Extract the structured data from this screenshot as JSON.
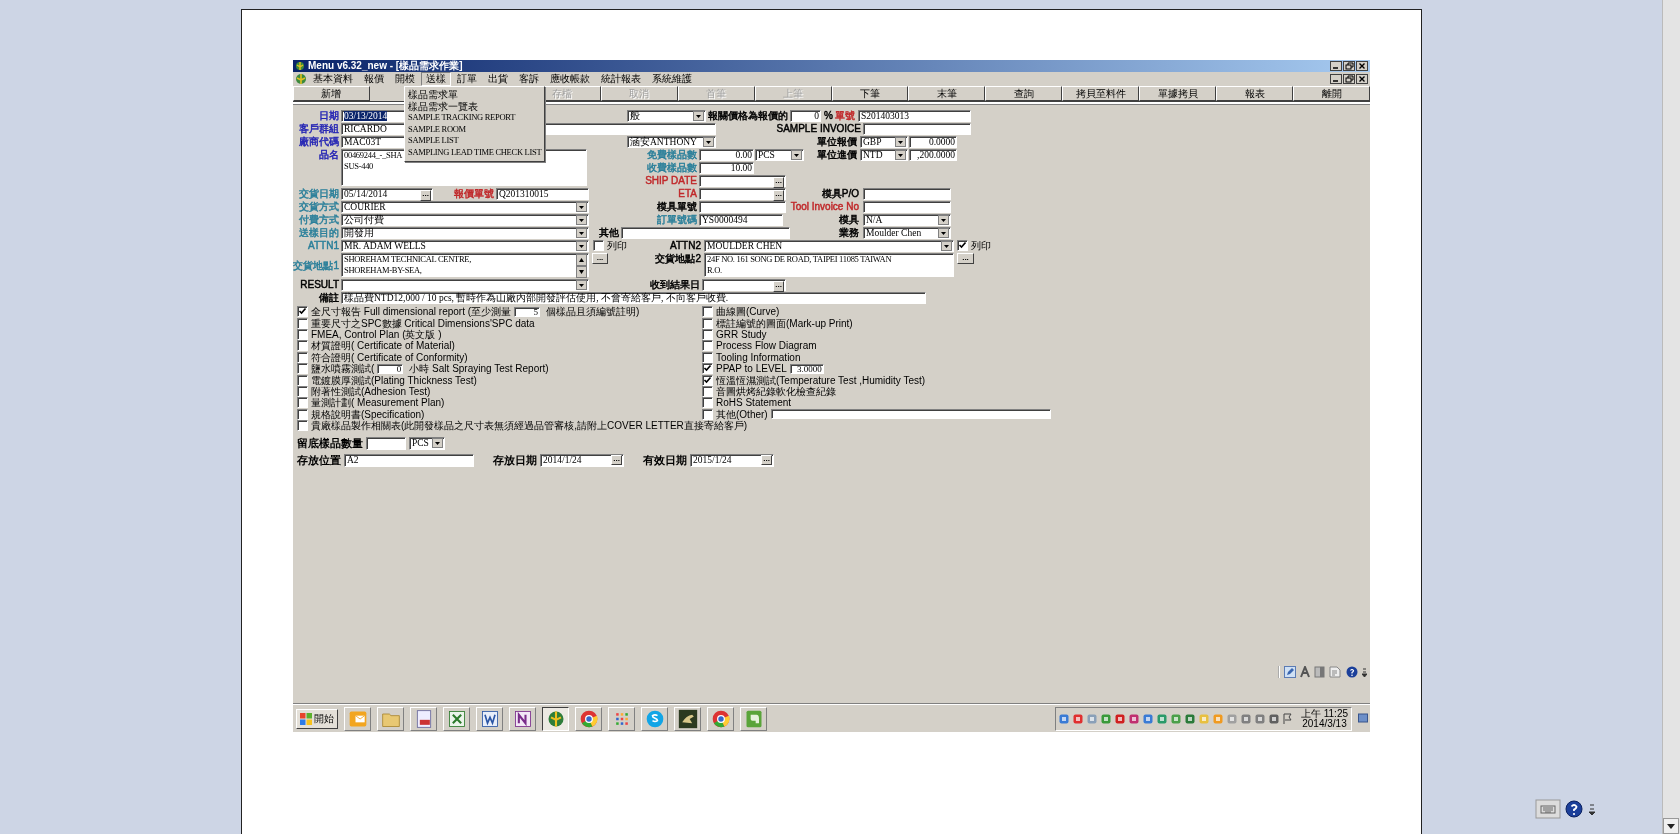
{
  "window": {
    "title": "Menu v6.32_new - [樣品需求作業]"
  },
  "menu_bar": {
    "items": [
      {
        "label": "基本資料",
        "selected": false
      },
      {
        "label": "報價",
        "selected": false
      },
      {
        "label": "開模",
        "selected": false
      },
      {
        "label": "送樣",
        "selected": true
      },
      {
        "label": "訂單",
        "selected": false
      },
      {
        "label": "出貨",
        "selected": false
      },
      {
        "label": "客訴",
        "selected": false
      },
      {
        "label": "應收帳款",
        "selected": false
      },
      {
        "label": "統計報表",
        "selected": false
      },
      {
        "label": "系統維護",
        "selected": false
      }
    ]
  },
  "dropdown_menu": {
    "items": [
      "樣品需求單",
      "樣品需求一覽表",
      "SAMPLE TRACKING REPORT",
      "SAMPLE ROOM",
      "SAMPLE LIST",
      "SAMPLING LEAD TIME CHECK LIST"
    ]
  },
  "toolbar": {
    "buttons": [
      {
        "label": "新增",
        "disabled": false
      },
      {
        "label": "存檔",
        "disabled": true
      },
      {
        "label": "取消",
        "disabled": true
      },
      {
        "label": "首筆",
        "disabled": true
      },
      {
        "label": "上筆",
        "disabled": true
      },
      {
        "label": "下筆",
        "disabled": false
      },
      {
        "label": "末筆",
        "disabled": false
      },
      {
        "label": "查詢",
        "disabled": false
      },
      {
        "label": "拷貝至料件",
        "disabled": false
      },
      {
        "label": "單據拷貝",
        "disabled": false
      },
      {
        "label": "報表",
        "disabled": false
      },
      {
        "label": "離開",
        "disabled": false
      }
    ]
  },
  "form": {
    "items": [
      {
        "kind": "label",
        "text": "日期",
        "color": "#2424b4"
      },
      {
        "kind": "text",
        "value": "03/13/2014",
        "highlighted": true
      },
      {
        "kind": "combo",
        "value": "般"
      },
      {
        "kind": "label",
        "text": "報關價格為報價的",
        "color": "#000000"
      },
      {
        "kind": "number",
        "value": "0"
      },
      {
        "kind": "label",
        "text": "%"
      },
      {
        "kind": "label",
        "text": "單號",
        "color": "#c0282a"
      },
      {
        "kind": "text",
        "value": "S201403013"
      },
      {
        "kind": "label",
        "text": "客戶群組",
        "color": "#2424b4"
      },
      {
        "kind": "text",
        "value": "RICARDO"
      },
      {
        "kind": "label",
        "text": "SAMPLE INVOICE",
        "color": "#000000"
      },
      {
        "kind": "text"
      },
      {
        "kind": "label",
        "text": "廠商代碼",
        "color": "#2424b4"
      },
      {
        "kind": "text",
        "value": "MAC03T"
      },
      {
        "kind": "combo",
        "value": "涵安ANTHONY"
      },
      {
        "kind": "label",
        "text": "單位報價",
        "color": "#000000"
      },
      {
        "kind": "combo",
        "value": "GBP"
      },
      {
        "kind": "number",
        "value": "0.0000"
      },
      {
        "kind": "label",
        "text": "品名",
        "color": "#2424b4"
      },
      {
        "kind": "memo",
        "lines": [
          "00469244_-_SHA",
          "SUS-440"
        ],
        "scrollbar": false
      },
      {
        "kind": "label",
        "text": "免費樣品數",
        "color": "#2a7f9a"
      },
      {
        "kind": "number",
        "value": "0.00"
      },
      {
        "kind": "combo",
        "value": "PCS"
      },
      {
        "kind": "label",
        "text": "單位進價",
        "color": "#000000"
      },
      {
        "kind": "combo",
        "value": "NTD"
      },
      {
        "kind": "number",
        "value": ",200.0000"
      },
      {
        "kind": "label",
        "text": "收費樣品數",
        "color": "#2a7f9a"
      },
      {
        "kind": "number",
        "value": "10.00"
      },
      {
        "kind": "label",
        "text": "SHIP DATE",
        "color": "#c0282a"
      },
      {
        "kind": "date",
        "button": "..."
      },
      {
        "kind": "label",
        "text": "交貨日期",
        "color": "#2a7f9a"
      },
      {
        "kind": "date",
        "value": "05/14/2014",
        "button": "..."
      },
      {
        "kind": "label",
        "text": "報價單號",
        "color": "#c0282a"
      },
      {
        "kind": "text",
        "value": "Q201310015"
      },
      {
        "kind": "label",
        "text": "ETA",
        "color": "#c0282a"
      },
      {
        "kind": "date",
        "button": "..."
      },
      {
        "kind": "label",
        "text": "模具P/O",
        "color": "#000000"
      },
      {
        "kind": "text"
      },
      {
        "kind": "label",
        "text": "交貨方式",
        "color": "#2a7f9a"
      },
      {
        "kind": "combo",
        "value": "COURIER"
      },
      {
        "kind": "label",
        "text": "模具單號",
        "color": "#000000"
      },
      {
        "kind": "text"
      },
      {
        "kind": "label",
        "text": "Tool Invoice No",
        "color": "#c0282a"
      },
      {
        "kind": "text"
      },
      {
        "kind": "label",
        "text": "付費方式",
        "color": "#2a7f9a"
      },
      {
        "kind": "combo",
        "value": "公司付費"
      },
      {
        "kind": "label",
        "text": "訂單號碼",
        "color": "#2a7f9a"
      },
      {
        "kind": "text",
        "value": "YS0000494"
      },
      {
        "kind": "label",
        "text": "模具",
        "color": "#000000"
      },
      {
        "kind": "combo",
        "value": "N/A"
      },
      {
        "kind": "label",
        "text": "送樣目的",
        "color": "#2a7f9a"
      },
      {
        "kind": "combo",
        "value": "開發用"
      },
      {
        "kind": "label",
        "text": "其他",
        "color": "#000000"
      },
      {
        "kind": "text"
      },
      {
        "kind": "label",
        "text": "業務",
        "color": "#000000"
      },
      {
        "kind": "combo",
        "value": "Moulder Chen"
      },
      {
        "kind": "label",
        "text": "ATTN1",
        "color": "#2a7f9a"
      },
      {
        "kind": "combo",
        "value": "MR. ADAM WELLS"
      },
      {
        "kind": "checkbox",
        "text": "列印",
        "checked": false
      },
      {
        "kind": "label",
        "text": "ATTN2",
        "color": "#000000"
      },
      {
        "kind": "combo",
        "value": "MOULDER CHEN"
      },
      {
        "kind": "checkbox",
        "text": "列印",
        "checked": true
      },
      {
        "kind": "label",
        "text": "交貨地點1",
        "color": "#2a7f9a"
      },
      {
        "kind": "memo",
        "lines": [
          "SHOREHAM TECHNICAL CENTRE,",
          "SHOREHAM-BY-SEA,"
        ],
        "scrollbar": true
      },
      {
        "kind": "button",
        "text": "..."
      },
      {
        "kind": "label",
        "text": "交貨地點2",
        "color": "#000000"
      },
      {
        "kind": "memo",
        "lines": [
          "24F NO. 161 SONG DE ROAD, TAIPEI 11085 TAIWAN",
          "R.O."
        ],
        "scrollbar": false
      },
      {
        "kind": "button",
        "text": "..."
      },
      {
        "kind": "label",
        "text": "RESULT",
        "color": "#000000"
      },
      {
        "kind": "combo"
      },
      {
        "kind": "label",
        "text": "收到結果日",
        "color": "#000000"
      },
      {
        "kind": "date",
        "button": "..."
      },
      {
        "kind": "label",
        "text": "備註",
        "color": "#000000"
      },
      {
        "kind": "text",
        "value": "樣品費NTD12,000 / 10 pcs, 暫時作為山廠內部開發評估使用, 不會寄給客戶, 不向客戶收費."
      }
    ]
  },
  "checklist": {
    "left": [
      {
        "kind": "field",
        "text": "全尺寸報告 Full dimensional report (至少測量",
        "field_value": "5",
        "text_after": "個樣品且須編號註明)",
        "checked": true
      },
      {
        "kind": "plain",
        "text": "重要尺寸之SPC數據 Critical Dimensions'SPC data",
        "checked": false
      },
      {
        "kind": "plain",
        "text": "FMEA, Control Plan (英文版 )",
        "checked": false
      },
      {
        "kind": "plain",
        "text": "材質證明( Certificate of Material)",
        "checked": false
      },
      {
        "kind": "plain",
        "text": "符合證明( Certificate of Conformity)",
        "checked": false
      },
      {
        "kind": "field",
        "text": "鹽水噴霧測試(",
        "field_value": "0",
        "text_after": "小時 Salt Spraying Test Report)",
        "checked": false
      },
      {
        "kind": "plain",
        "text": "電鍍膜厚測試(Plating Thickness Test)",
        "checked": false
      },
      {
        "kind": "plain",
        "text": "附著性測試(Adhesion Test)",
        "checked": false
      },
      {
        "kind": "plain",
        "text": "量測計劃( Measurement Plan)",
        "checked": false
      },
      {
        "kind": "plain",
        "text": "規格說明書(Specification)",
        "checked": false
      }
    ],
    "right": [
      {
        "kind": "plain",
        "text": "曲線圖(Curve)",
        "checked": false
      },
      {
        "kind": "plain",
        "text": "標註編號的圖面(Mark-up Print)",
        "checked": false
      },
      {
        "kind": "plain",
        "text": "GRR Study",
        "checked": false
      },
      {
        "kind": "plain",
        "text": "Process Flow Diagram",
        "checked": false
      },
      {
        "kind": "plain",
        "text": "Tooling Information",
        "checked": false
      },
      {
        "kind": "field",
        "text": "PPAP  to LEVEL",
        "field_value": "3.0000",
        "checked": true
      },
      {
        "kind": "plain",
        "text": "恆溫恆濕測試(Temperature Test ,Humidity Test)",
        "checked": true
      },
      {
        "kind": "plain",
        "text": "音圖烘烤紀錄軟化檢查紀錄",
        "checked": false
      },
      {
        "kind": "plain",
        "text": "RoHS Statement",
        "checked": false
      },
      {
        "kind": "field",
        "text": "其他(Other)",
        "checked": false
      }
    ],
    "full_width": [
      {
        "kind": "plain",
        "text": "貴廠樣品製作相關表(此開發樣品之尺寸表無須經過品管審核,請附上COVER LETTER直接寄給客戶)",
        "checked": false
      }
    ]
  },
  "retention": {
    "label": "留底樣品數量",
    "unit": "PCS"
  },
  "storage": {
    "location_label": "存放位置",
    "location": "A2",
    "date_label": "存放日期",
    "date": "2014/1/24",
    "date_button": "...",
    "expiry_label": "有效日期",
    "expiry": "2015/1/24",
    "expiry_button": "..."
  },
  "taskbar": {
    "start_label": "開始",
    "apps": [
      {
        "selected": false
      },
      {
        "selected": false
      },
      {
        "selected": false
      },
      {
        "selected": false
      },
      {
        "selected": false
      },
      {
        "selected": false
      },
      {
        "selected": true
      },
      {
        "selected": false
      },
      {
        "selected": false
      },
      {
        "selected": false
      },
      {
        "selected": false
      },
      {
        "selected": false
      },
      {
        "selected": false
      }
    ],
    "clock": {
      "time": "上午 11:25",
      "date": "2014/3/13"
    }
  }
}
